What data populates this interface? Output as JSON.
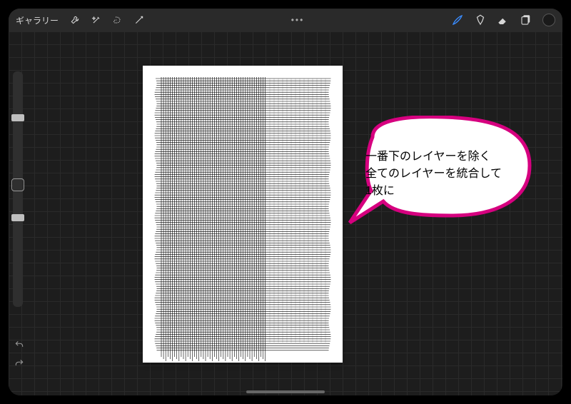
{
  "topbar": {
    "gallery": "ギャラリー",
    "menu": "•••"
  },
  "annotation": {
    "line1": "一番下のレイヤーを除く",
    "line2": "全てのレイヤーを統合して",
    "line3": "1枚に"
  },
  "colors": {
    "accent": "#3a8cff",
    "bubble_stroke": "#d6007f"
  }
}
